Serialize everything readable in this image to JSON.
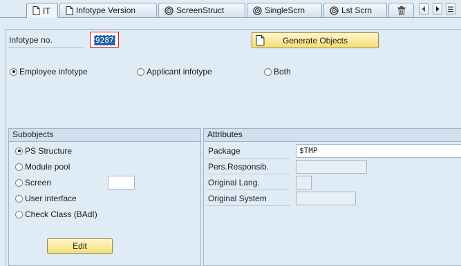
{
  "tabs": [
    {
      "label": "IT",
      "icon": "document-icon",
      "active": true
    },
    {
      "label": "Infotype Version",
      "icon": "document-icon",
      "active": false
    },
    {
      "label": "ScreenStruct",
      "icon": "spiral-icon",
      "active": false
    },
    {
      "label": "SingleScrn",
      "icon": "spiral-icon",
      "active": false
    },
    {
      "label": "Lst Scrn",
      "icon": "spiral-icon",
      "active": false
    }
  ],
  "header": {
    "infotype_label": "Infotype no.",
    "infotype_value": "9287",
    "generate_button": "Generate Objects"
  },
  "infotype_types": [
    {
      "label": "Employee infotype",
      "selected": true
    },
    {
      "label": "Applicant infotype",
      "selected": false
    },
    {
      "label": "Both",
      "selected": false
    }
  ],
  "subobjects": {
    "title": "Subobjects",
    "options": [
      {
        "label": "PS Structure",
        "selected": true
      },
      {
        "label": "Module pool",
        "selected": false
      },
      {
        "label": "Screen",
        "selected": false
      },
      {
        "label": "User interface",
        "selected": false
      },
      {
        "label": "Check Class (BAdI)",
        "selected": false
      }
    ],
    "screen_value": "",
    "edit_button": "Edit"
  },
  "attributes": {
    "title": "Attributes",
    "package_label": "Package",
    "package_value": "$TMP",
    "pers_resp_label": "Pers.Responsib.",
    "pers_resp_value": "",
    "orig_lang_label": "Original Lang.",
    "orig_lang_value": "",
    "orig_system_label": "Original System",
    "orig_system_value": ""
  },
  "colors": {
    "background": "#dfebf5",
    "button_yellow": "#f6de78",
    "selection_blue": "#1f5fa8",
    "focus_red": "#d11a1a"
  }
}
